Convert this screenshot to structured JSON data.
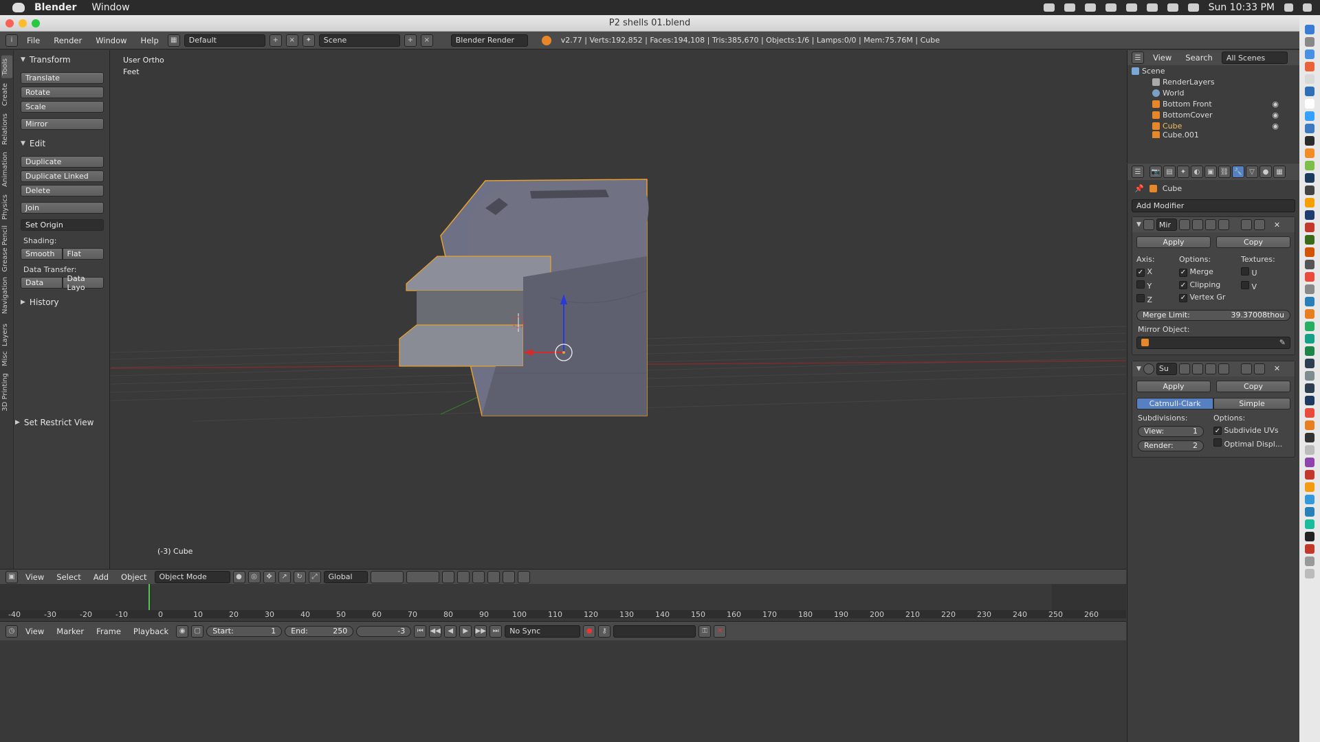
{
  "mac_bar": {
    "app_name": "Blender",
    "window_menu": "Window",
    "clock": "Sun 10:33 PM"
  },
  "window": {
    "title": "P2 shells 01.blend"
  },
  "info_header": {
    "menus": [
      "File",
      "Render",
      "Window",
      "Help"
    ],
    "layout": "Default",
    "scene": "Scene",
    "engine": "Blender Render",
    "stats": "v2.77 | Verts:192,852 | Faces:194,108 | Tris:385,670 | Objects:1/6 | Lamps:0/0 | Mem:75.76M | Cube"
  },
  "tool_tabs": [
    "Tools",
    "Create",
    "Relations",
    "Animation",
    "Physics",
    "Grease Pencil",
    "Navigation",
    "Layers",
    "Misc",
    "3D Printing"
  ],
  "tool_shelf": {
    "transform_title": "Transform",
    "translate": "Translate",
    "rotate": "Rotate",
    "scale": "Scale",
    "mirror": "Mirror",
    "edit_title": "Edit",
    "duplicate": "Duplicate",
    "duplicate_linked": "Duplicate Linked",
    "delete": "Delete",
    "join": "Join",
    "set_origin": "Set Origin",
    "shading_label": "Shading:",
    "smooth": "Smooth",
    "flat": "Flat",
    "data_transfer_label": "Data Transfer:",
    "data": "Data",
    "data_layo": "Data Layo",
    "history_title": "History",
    "restrict_title": "Set Restrict View"
  },
  "viewport": {
    "view_label": "User Ortho",
    "units_label": "Feet",
    "object_label": "(-3) Cube"
  },
  "viewport_header": {
    "menus": [
      "View",
      "Select",
      "Add",
      "Object"
    ],
    "mode": "Object Mode",
    "orientation": "Global"
  },
  "timeline": {
    "ticks": [
      "-40",
      "-30",
      "-20",
      "-10",
      "0",
      "10",
      "20",
      "30",
      "40",
      "50",
      "60",
      "70",
      "80",
      "90",
      "100",
      "110",
      "120",
      "130",
      "140",
      "150",
      "160",
      "170",
      "180",
      "190",
      "200",
      "210",
      "220",
      "230",
      "240",
      "250",
      "260"
    ],
    "menus": [
      "View",
      "Marker",
      "Frame",
      "Playback"
    ],
    "start_label": "Start:",
    "start_value": "1",
    "end_label": "End:",
    "end_value": "250",
    "current_frame": "-3",
    "sync": "No Sync"
  },
  "outliner": {
    "menus": [
      "View",
      "Search"
    ],
    "filter": "All Scenes",
    "items": [
      "Scene",
      "RenderLayers",
      "World",
      "Bottom Front",
      "BottomCover",
      "Cube",
      "Cube.001"
    ]
  },
  "properties": {
    "object_name": "Cube",
    "add_modifier": "Add Modifier",
    "mirror": {
      "name": "Mir",
      "apply": "Apply",
      "copy": "Copy",
      "axis_label": "Axis:",
      "options_label": "Options:",
      "textures_label": "Textures:",
      "x": "X",
      "y": "Y",
      "z": "Z",
      "merge": "Merge",
      "clipping": "Clipping",
      "vertex_gr": "Vertex Gr",
      "u": "U",
      "v": "V",
      "merge_limit_label": "Merge Limit:",
      "merge_limit_value": "39.37008thou",
      "mirror_object_label": "Mirror Object:"
    },
    "subsurf": {
      "name": "Su",
      "apply": "Apply",
      "copy": "Copy",
      "catmull": "Catmull-Clark",
      "simple": "Simple",
      "subdivisions_label": "Subdivisions:",
      "options_label": "Options:",
      "view_label": "View:",
      "view_value": "1",
      "render_label": "Render:",
      "render_value": "2",
      "subdivide_uvs": "Subdivide UVs",
      "optimal_display": "Optimal Displ..."
    }
  }
}
